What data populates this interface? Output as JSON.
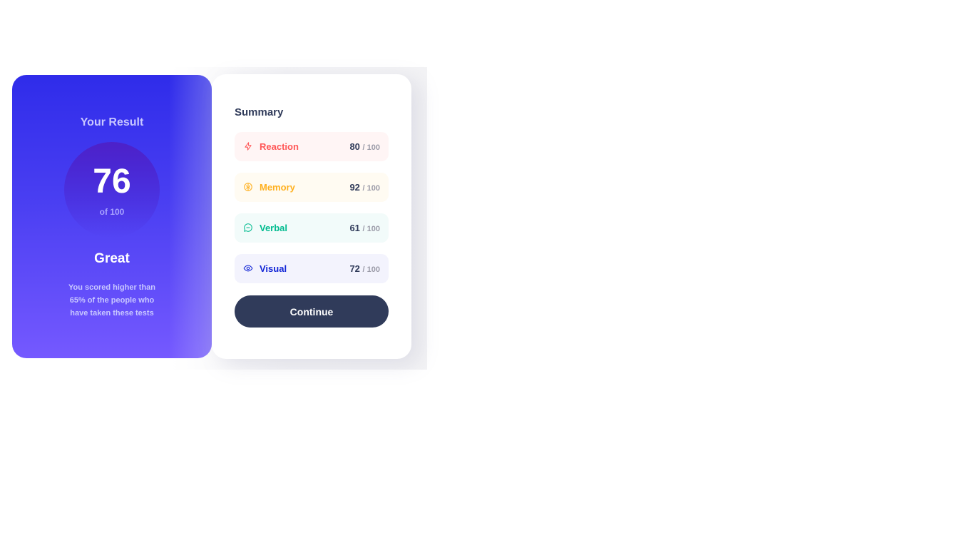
{
  "result": {
    "heading": "Your Result",
    "score": "76",
    "score_total": "of 100",
    "grade": "Great",
    "description": "You scored higher than 65% of the people who have taken these tests"
  },
  "summary": {
    "title": "Summary",
    "items": [
      {
        "label": "Reaction",
        "score": "80",
        "total": "/ 100",
        "icon": "lightning-icon",
        "color": "#ff5757",
        "bg": "#fff5f5"
      },
      {
        "label": "Memory",
        "score": "92",
        "total": "/ 100",
        "icon": "brain-icon",
        "color": "#ffb01f",
        "bg": "#fffbf2"
      },
      {
        "label": "Verbal",
        "score": "61",
        "total": "/ 100",
        "icon": "chat-icon",
        "color": "#00bb8f",
        "bg": "#f2fbfa"
      },
      {
        "label": "Visual",
        "score": "72",
        "total": "/ 100",
        "icon": "eye-icon",
        "color": "#1125d6",
        "bg": "#f3f3fd"
      }
    ],
    "continue_label": "Continue"
  },
  "colors": {
    "panel_gradient_top": "#2f2cea",
    "panel_gradient_bottom": "#7559ff",
    "button": "#303b5a",
    "text_dark": "#303b5a"
  }
}
